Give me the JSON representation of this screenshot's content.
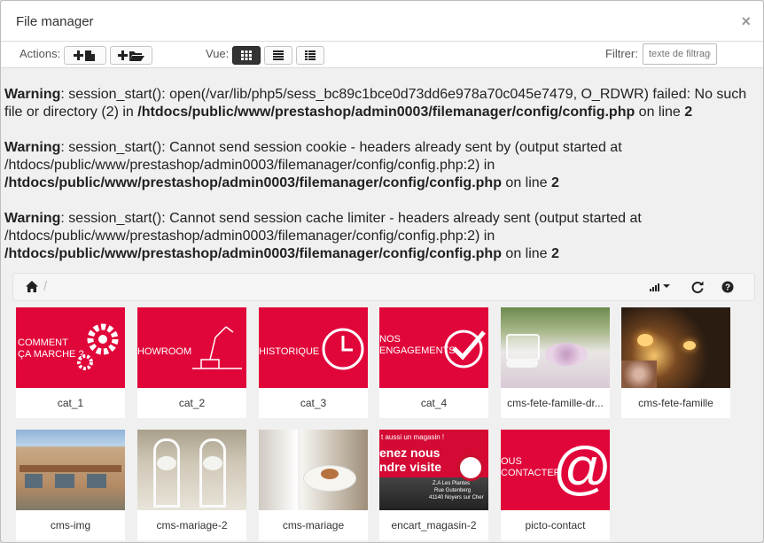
{
  "window": {
    "title": "File manager"
  },
  "toolbar": {
    "actions_label": "Actions:",
    "vue_label": "Vue:",
    "filter_label": "Filtrer:",
    "filter_placeholder": "texte de filtrage"
  },
  "warnings": [
    {
      "label": "Warning",
      "text": ": session_start(): open(/var/lib/php5/sess_bc89c1bce0d73dd6e978a70c045e7479, O_RDWR) failed: No such file or directory (2) in ",
      "path": "/htdocs/public/www/prestashop/admin0003/filemanager/config/config.php",
      "line_text": " on line ",
      "line": "2"
    },
    {
      "label": "Warning",
      "text": ": session_start(): Cannot send session cookie - headers already sent by (output started at /htdocs/public/www/prestashop/admin0003/filemanager/config/config.php:2) in ",
      "path": "/htdocs/public/www/prestashop/admin0003/filemanager/config/config.php",
      "line_text": " on line ",
      "line": "2"
    },
    {
      "label": "Warning",
      "text": ": session_start(): Cannot send session cache limiter - headers already sent (output started at /htdocs/public/www/prestashop/admin0003/filemanager/config/config.php:2) in ",
      "path": "/htdocs/public/www/prestashop/admin0003/filemanager/config/config.php",
      "line_text": " on line ",
      "line": "2"
    }
  ],
  "breadcrumb": {
    "separator": "/"
  },
  "files": [
    {
      "name": "cat_1",
      "thumb_text": "COMMENT\nÇA MARCHE ?",
      "kind": "red-gears"
    },
    {
      "name": "cat_2",
      "thumb_text": "HOWROOM",
      "kind": "red-lamp"
    },
    {
      "name": "cat_3",
      "thumb_text": "HISTORIQUE",
      "kind": "red-clock"
    },
    {
      "name": "cat_4",
      "thumb_text": "NOS\nENGAGEMENTS",
      "kind": "red-check"
    },
    {
      "name": "cms-fete-famille-dr...",
      "kind": "photo-candy"
    },
    {
      "name": "cms-fete-famille",
      "kind": "photo-candles"
    },
    {
      "name": "cms-img",
      "kind": "photo-building"
    },
    {
      "name": "cms-mariage-2",
      "kind": "photo-chairs"
    },
    {
      "name": "cms-mariage",
      "kind": "photo-buffet"
    },
    {
      "name": "encart_magasin-2",
      "kind": "photo-store",
      "lines": [
        "t aussi un magasin !",
        "enez nous",
        "ndre visite",
        "Z.A Les Plantes",
        "Rue Gutenberg",
        "41140 Noyers sur Cher"
      ]
    },
    {
      "name": "picto-contact",
      "thumb_text": "OUS\nCONTACTER",
      "kind": "red-at"
    }
  ],
  "colors": {
    "brand_red": "#e1063a",
    "warning_text": "#222222"
  }
}
